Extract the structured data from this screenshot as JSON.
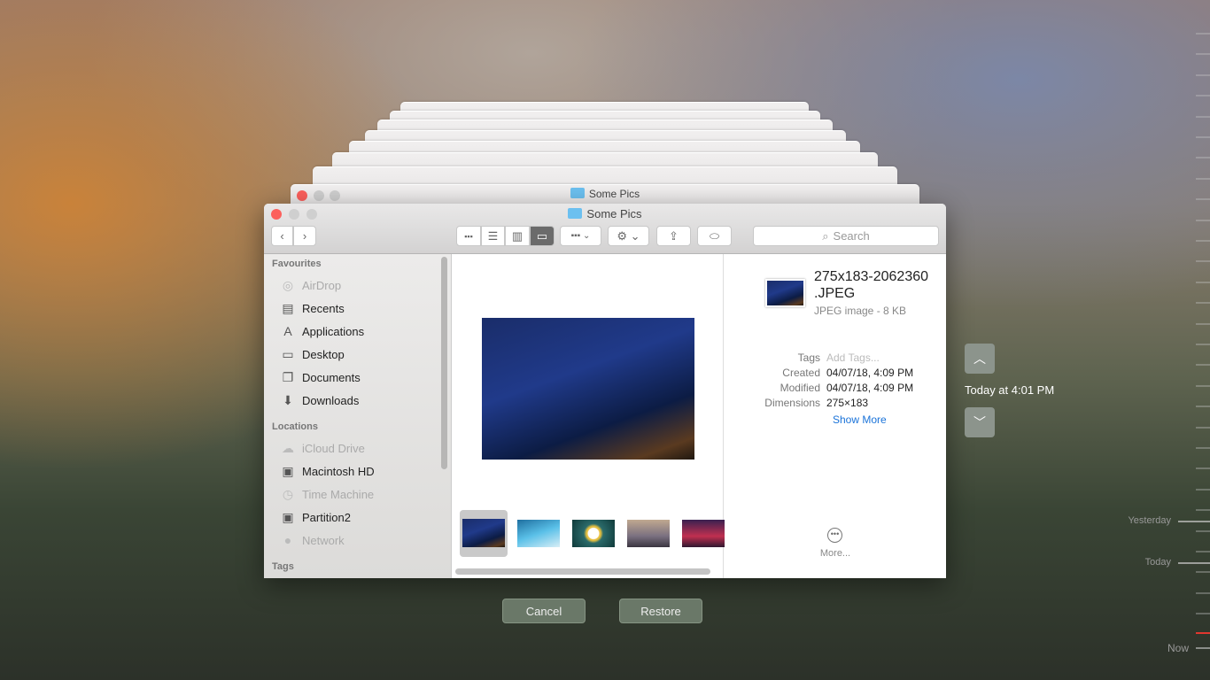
{
  "window": {
    "title": "Some Pics",
    "back_title": "Some Pics"
  },
  "toolbar": {
    "search_placeholder": "Search"
  },
  "sidebar": {
    "favourites_header": "Favourites",
    "favourites": [
      {
        "label": "AirDrop",
        "icon": "airdrop-icon",
        "dim": true
      },
      {
        "label": "Recents",
        "icon": "recents-icon"
      },
      {
        "label": "Applications",
        "icon": "applications-icon"
      },
      {
        "label": "Desktop",
        "icon": "desktop-icon"
      },
      {
        "label": "Documents",
        "icon": "documents-icon"
      },
      {
        "label": "Downloads",
        "icon": "downloads-icon"
      }
    ],
    "locations_header": "Locations",
    "locations": [
      {
        "label": "iCloud Drive",
        "icon": "cloud-icon",
        "dim": true
      },
      {
        "label": "Macintosh HD",
        "icon": "disk-icon"
      },
      {
        "label": "Time Machine",
        "icon": "time-machine-icon",
        "dim": true
      },
      {
        "label": "Partition2",
        "icon": "disk-icon"
      },
      {
        "label": "Network",
        "icon": "network-icon",
        "dim": true
      }
    ],
    "tags_header": "Tags"
  },
  "inspector": {
    "filename": "275x183-2062360\n.JPEG",
    "filename_l1": "275x183-2062360",
    "filename_l2": ".JPEG",
    "kind": "JPEG image - 8 KB",
    "rows": [
      {
        "k": "Tags",
        "v": "Add Tags..."
      },
      {
        "k": "Created",
        "v": "04/07/18, 4:09 PM"
      },
      {
        "k": "Modified",
        "v": "04/07/18, 4:09 PM"
      },
      {
        "k": "Dimensions",
        "v": "275×183"
      }
    ],
    "show_more": "Show More",
    "more": "More..."
  },
  "time_machine": {
    "current": "Today at 4:01 PM",
    "timeline": [
      "Yesterday",
      "Today",
      "Now"
    ],
    "cancel": "Cancel",
    "restore": "Restore"
  },
  "colors": {
    "accent": "#1a73d9",
    "close": "#fc605c",
    "now_marker": "#e0372f"
  }
}
